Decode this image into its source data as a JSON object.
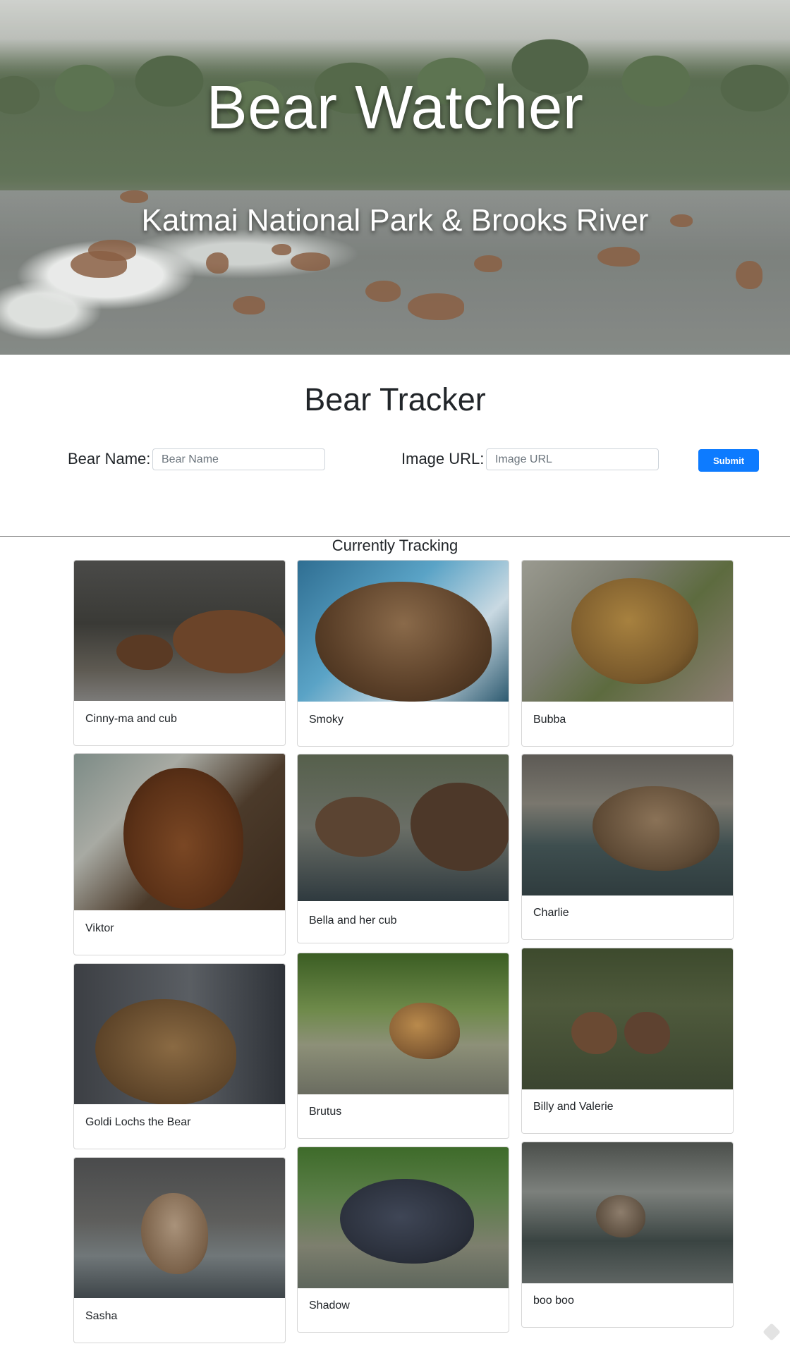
{
  "hero": {
    "title": "Bear Watcher",
    "subtitle": "Katmai National Park & Brooks River"
  },
  "tracker": {
    "title": "Bear Tracker",
    "name_label": "Bear Name:",
    "name_placeholder": "Bear Name",
    "name_value": "",
    "url_label": "Image URL:",
    "url_placeholder": "Image URL",
    "url_value": "",
    "submit_label": "Submit"
  },
  "tracking": {
    "title": "Currently Tracking",
    "bears": [
      {
        "name": "Cinny-ma and cub"
      },
      {
        "name": "Smoky"
      },
      {
        "name": "Bubba"
      },
      {
        "name": "Viktor"
      },
      {
        "name": "Bella and her cub"
      },
      {
        "name": "Charlie"
      },
      {
        "name": "Goldi Lochs the Bear"
      },
      {
        "name": "Brutus"
      },
      {
        "name": "Billy and Valerie"
      },
      {
        "name": "Sasha"
      },
      {
        "name": "Shadow"
      },
      {
        "name": "boo boo"
      }
    ]
  },
  "colors": {
    "accent": "#0d7bff",
    "text": "#212529",
    "border": "#ced4da"
  },
  "icons": {
    "corner": "diamond-icon"
  }
}
